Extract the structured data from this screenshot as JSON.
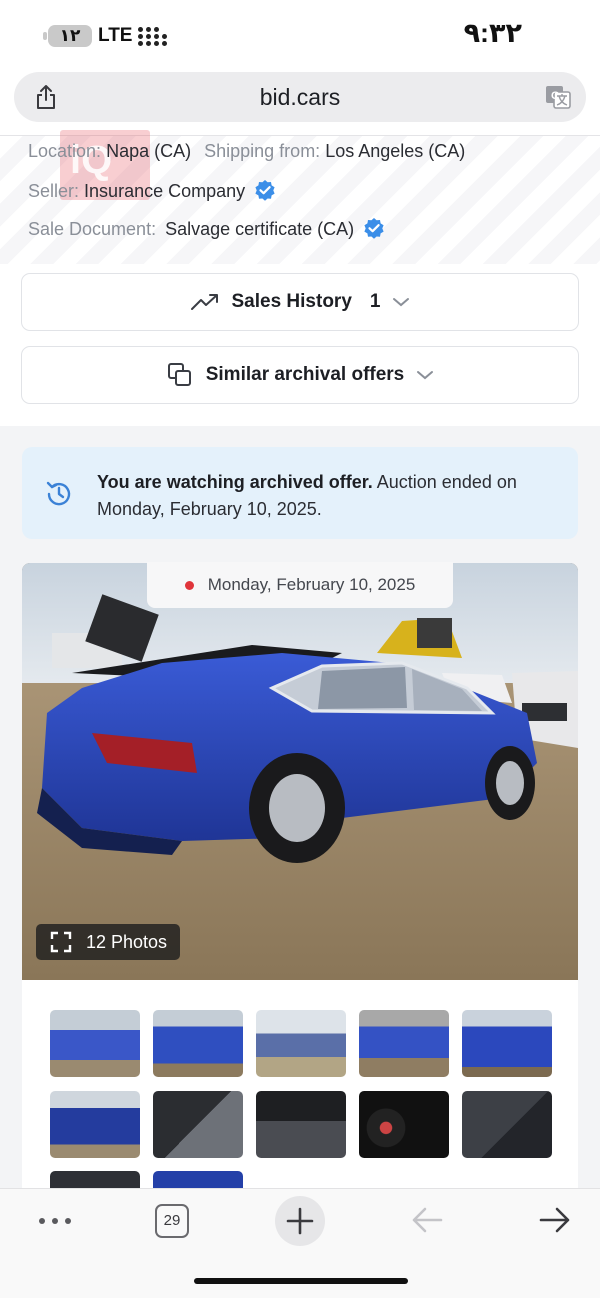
{
  "status_bar": {
    "battery": "۱۲",
    "network": "LTE",
    "time": "۹:۳۲"
  },
  "browser": {
    "url": "bid.cars"
  },
  "details": {
    "location_label": "Location:",
    "location_value": "Napa (CA)",
    "shipping_label": "Shipping from:",
    "shipping_value": "Los Angeles (CA)",
    "seller_label": "Seller:",
    "seller_value": "Insurance Company",
    "document_label": "Sale Document:",
    "document_value": "Salvage certificate (CA)",
    "watermark": "iQ"
  },
  "sales_history": {
    "label": "Sales History",
    "count": "1"
  },
  "similar_offers": {
    "label": "Similar archival offers"
  },
  "notice": {
    "bold": "You are watching archived offer.",
    "rest": " Auction ended on Monday, February 10, 2025."
  },
  "main_photo": {
    "date": "Monday, February 10, 2025",
    "photos_label": "12 Photos",
    "status_dot_color": "#e0353b"
  },
  "thumbnails": [
    {
      "name": "thumb-front-left"
    },
    {
      "name": "thumb-rear-left"
    },
    {
      "name": "thumb-side-left"
    },
    {
      "name": "thumb-front-right"
    },
    {
      "name": "thumb-front"
    },
    {
      "name": "thumb-rear"
    },
    {
      "name": "thumb-driver-interior"
    },
    {
      "name": "thumb-dashboard"
    },
    {
      "name": "thumb-gauges"
    },
    {
      "name": "thumb-rear-seats"
    },
    {
      "name": "thumb-engine"
    },
    {
      "name": "thumb-seat-detail"
    }
  ],
  "toolbar": {
    "tab_count": "29"
  },
  "colors": {
    "accent": "#3b82d6",
    "notice_bg": "#e4f1fb",
    "car_blue": "#2a45b5"
  }
}
